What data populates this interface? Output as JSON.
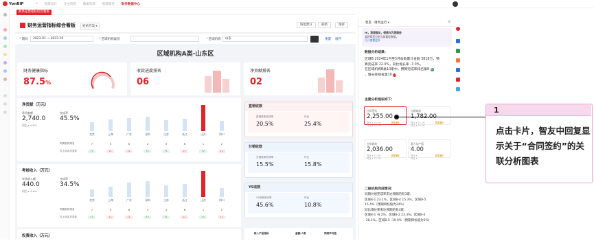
{
  "app": {
    "logo": "YonBIP",
    "nav": [
      "首页",
      "智能设计",
      "企业流程",
      "数据资源",
      "智能服务"
    ],
    "active_nav": "财务数据中心"
  },
  "tab": {
    "label": "财务运营指标综合看板"
  },
  "header": {
    "title": "财务运营指标综合看板",
    "plan": "初始方案 ▾",
    "buttons": [
      "恢复默认",
      "刷新",
      "保存"
    ]
  },
  "filters": {
    "period_label": "* 期间",
    "period_from": "2023-01",
    "period_to": "2023-10",
    "region_label": "* 区域机构类别",
    "org_label": "* 区域机构",
    "org_value": "山东",
    "reset": "重置",
    "expand": "展开"
  },
  "region_title": "区域机构A类-山东区",
  "kpis": [
    {
      "label": "财务健康指标",
      "value": "87.5",
      "unit": "%"
    },
    {
      "label": "收款进度排名",
      "value": "06"
    },
    {
      "label": "净贡献排名",
      "value": "02"
    }
  ],
  "net_contrib": {
    "title": "净贡献（万元）",
    "m1_label": "净贡献额",
    "m1_value": "2,740.0",
    "m1_note": "同比 ▾ 4.6%",
    "m2_label": "完成率",
    "m2_value": "45.5%",
    "cities": [
      "北京",
      "上海",
      "广东",
      "深圳",
      "江苏",
      "浙江",
      "山东",
      "四川"
    ],
    "bars": [
      0.35,
      0.45,
      0.5,
      0.55,
      0.42,
      0.48,
      1.0,
      0.4
    ],
    "row1_label": "同类机构排名",
    "row1": [
      "7",
      "5",
      "6",
      "4",
      "3",
      "6",
      "1",
      "2"
    ],
    "row2_label": "与上月名次变化",
    "row2": [
      "↑1",
      "↓1",
      "↓1",
      "↑2",
      "↑1",
      "↓1",
      "↑2",
      "↓1"
    ]
  },
  "assessed": {
    "title": "考核收入（万元）",
    "m1_label": "考核收入额",
    "m1_value": "440.0",
    "m1_note": "同比 ▾ 4.6%",
    "m2_label": "完成率",
    "m2_value": "34.5%",
    "bars": [
      0.3,
      0.4,
      0.55,
      0.6,
      0.45,
      0.5,
      1.0,
      0.35
    ],
    "row1_label": "同类机构排名",
    "row1": [
      "7",
      "5",
      "6",
      "4",
      "3",
      "6",
      "1",
      "2"
    ],
    "row2_label": "与上月名次变化",
    "row2": [
      "↑1",
      "↓1",
      "↓1",
      "↑2",
      "↑1",
      "↓1",
      "↑2",
      "↓1"
    ]
  },
  "equity": {
    "title": "权责收入（万元）"
  },
  "direct": {
    "title": "直销收款",
    "l1": "直销收款完成率",
    "v1": "20.5%",
    "l2": "环比",
    "v2": "25.4%"
  },
  "dist": {
    "title": "分销收款",
    "l1": "分销收款完成率",
    "v1": "15.5%",
    "l2": "环比",
    "v2": "15.8%"
  },
  "ys": {
    "title": "YS收款",
    "l1": "YS收款完成率",
    "v1": "45.6%",
    "l2": "环比",
    "v2": "10.8%"
  },
  "table_head": [
    "新入产品指标",
    "金额/人数",
    "同类平均值"
  ],
  "assistant": {
    "title": "智友 · 财务运行 ▾",
    "welcome_h": "Hi，我是智友，很高兴为您服务",
    "welcome_1": "我将帮您分析当前看板数据，",
    "welcome_2": "打开查看更多",
    "analysis_title": "数据分析结果：",
    "analysis_1": "区域B 2024年1月至5月收款累计金额 3818万，预",
    "analysis_2": "算完成率 22.0%，同比增长率 -7.0%。",
    "analysis_3": "在区域机构B类10家中，预算完成率排名第8",
    "analysis_4": "，增长率排名第10",
    "main_title": "主要分析指标如下：",
    "minis": [
      {
        "label": "合同签约",
        "value": "2,255.00",
        "n1": "同比 ▾ 25.2%",
        "n2": "环比 ▾ 25.2%",
        "tag": "排名第1"
      },
      {
        "label": "当期收款",
        "value": "1,782.00",
        "n1": "同比 ▾ 25.2%",
        "n2": "环比 ▾ 25.2%",
        "tag": "排名第3"
      },
      {
        "label": "分销收款",
        "value": "2,036.00",
        "n1": "同比 ▾ 12.3%",
        "n2": "环比 ▾ 12.3%",
        "tag": "排名第4"
      },
      {
        "label": "客人均产值",
        "value": "4.00",
        "n1": "同比 ▾ --",
        "n2": "环比 ▾ --",
        "tag": "排名第2"
      }
    ],
    "sec_title": "二级机构完成情况：",
    "sec_1": "同期计划完成率未达预期的有3家:",
    "sec_2": "区域8-1 23.1%，区域8-4 15.3%，区域8-5",
    "sec_3": "15.4%（预期目标值为24%）",
    "sec_4": "同比增长率未达预期的有4家：",
    "sec_5": "区域8-1 -8.2%，区域8-2 23.3%，区域8-4",
    "sec_6": "-38.1%，区域8-5 -19.9%（预期目标值为5%）"
  },
  "callout": {
    "num": "1",
    "text": "点击卡片，智友中回复显示关于“合同签约”的关联分析图表"
  },
  "colors": {
    "brand": "#e0242b",
    "link": "#2a6fd8",
    "callout_border": "#e9a6d2"
  }
}
